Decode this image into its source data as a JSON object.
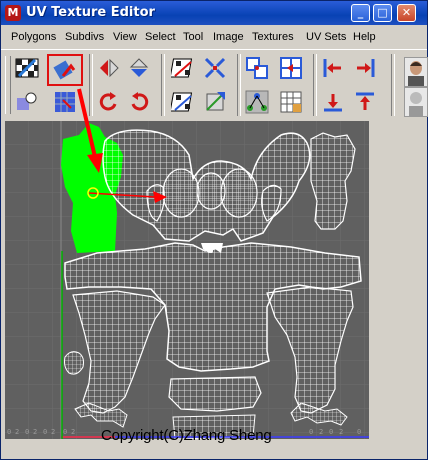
{
  "window": {
    "title": "UV Texture Editor",
    "app_icon": "maya-icon"
  },
  "menu": [
    "Polygons",
    "Subdivs",
    "View",
    "Select",
    "Tool",
    "Image",
    "Textures",
    "UV Sets",
    "Help"
  ],
  "viewport": {
    "grid_labels": [
      "0",
      "2",
      "0",
      "2",
      "0",
      "2",
      "0",
      "2",
      "0",
      "2",
      "0",
      "2",
      "0"
    ],
    "highlight_color": "#00ff00",
    "arrow_color": "#ff0000",
    "wireframe_color": "#ffffff",
    "background_color": "#606060"
  },
  "watermark": {
    "text": "Copyright(C)Zhang Sheng"
  },
  "colors": {
    "title_bar": "#0842b4",
    "chrome": "#d4d0c8",
    "selection_box": "#e01010"
  }
}
